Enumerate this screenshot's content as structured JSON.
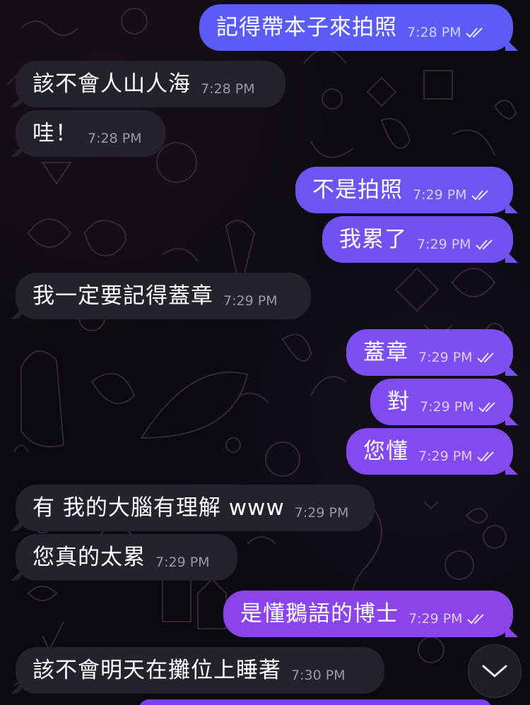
{
  "messages": [
    {
      "text": "記得帶本子來拍照",
      "time": "7:28 PM"
    },
    {
      "text": "該不會人山人海",
      "time": "7:28 PM"
    },
    {
      "text": "哇！",
      "time": "7:28 PM"
    },
    {
      "text": "不是拍照",
      "time": "7:29 PM"
    },
    {
      "text": "我累了",
      "time": "7:29 PM"
    },
    {
      "text": "我一定要記得蓋章",
      "time": "7:29 PM"
    },
    {
      "text": "蓋章",
      "time": "7:29 PM"
    },
    {
      "text": "對",
      "time": "7:29 PM"
    },
    {
      "text": "您懂",
      "time": "7:29 PM"
    },
    {
      "text": "有 我的大腦有理解 www",
      "time": "7:29 PM"
    },
    {
      "text": "您真的太累",
      "time": "7:29 PM"
    },
    {
      "text": "是懂鵝語的博士",
      "time": "7:29 PM"
    },
    {
      "text": "該不會明天在攤位上睡著",
      "time": "7:30 PM"
    }
  ],
  "icons": {
    "read_receipt": "double-check-icon",
    "scroll_down": "chevron-down-icon"
  },
  "colors": {
    "incoming_bubble": "#26222c",
    "outgoing_gradient_top": "#5b5cf6",
    "outgoing_gradient_bottom": "#8a3fe6",
    "background": "#0b0a0f"
  }
}
